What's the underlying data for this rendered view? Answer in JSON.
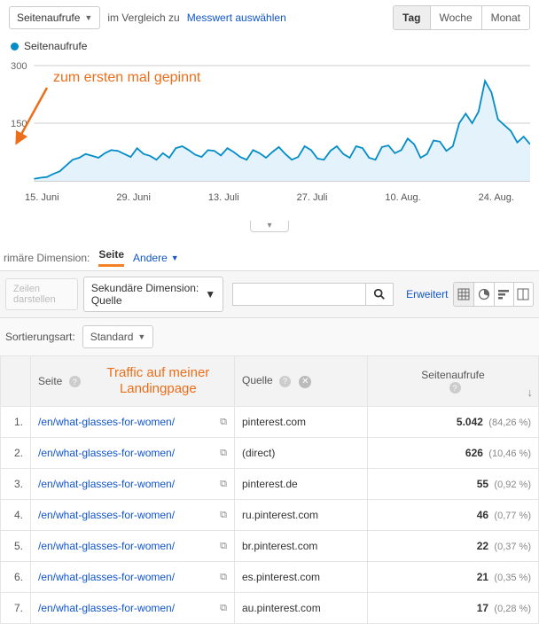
{
  "header": {
    "metric_dropdown": "Seitenaufrufe",
    "compare_label": "im Vergleich zu",
    "select_metric": "Messwert auswählen",
    "time_buttons": [
      "Tag",
      "Woche",
      "Monat"
    ],
    "time_selected": 0
  },
  "legend": {
    "label": "Seitenaufrufe"
  },
  "chart_data": {
    "type": "line",
    "title": "",
    "ylabel": "",
    "xlabel": "",
    "ylim": [
      0,
      300
    ],
    "yticks": [
      150,
      300
    ],
    "x_ticks": [
      "15. Juni",
      "29. Juni",
      "13. Juli",
      "27. Juli",
      "10. Aug.",
      "24. Aug."
    ],
    "series": [
      {
        "name": "Seitenaufrufe",
        "color": "#058dc7",
        "values": [
          5,
          8,
          10,
          18,
          25,
          40,
          55,
          60,
          70,
          65,
          60,
          72,
          80,
          78,
          70,
          62,
          85,
          70,
          65,
          55,
          72,
          60,
          85,
          90,
          80,
          68,
          62,
          80,
          78,
          66,
          85,
          75,
          62,
          55,
          80,
          72,
          60,
          75,
          88,
          70,
          55,
          62,
          90,
          80,
          58,
          55,
          78,
          90,
          70,
          60,
          90,
          85,
          60,
          55,
          88,
          92,
          72,
          80,
          110,
          95,
          60,
          70,
          105,
          102,
          78,
          90,
          150,
          175,
          150,
          180,
          260,
          230,
          160,
          145,
          130,
          100,
          115,
          95
        ]
      }
    ],
    "annotations": [
      "zum ersten mal gepinnt"
    ]
  },
  "dimension": {
    "label": "rimäre Dimension:",
    "primary": "Seite",
    "other": "Andere"
  },
  "filters": {
    "plot_rows": "Zeilen darstellen",
    "secondary_dim": "Sekundäre Dimension: Quelle",
    "advanced": "Erweitert",
    "search_placeholder": ""
  },
  "sort": {
    "label": "Sortierungsart:",
    "value": "Standard"
  },
  "table": {
    "headers": {
      "page": "Seite",
      "source": "Quelle",
      "pageviews": "Seitenaufrufe"
    },
    "annotation": "Traffic auf meiner Landingpage",
    "rows": [
      {
        "idx": "1.",
        "page": "/en/what-glasses-for-women/",
        "source": "pinterest.com",
        "pv": "5.042",
        "pct": "(84,26 %)"
      },
      {
        "idx": "2.",
        "page": "/en/what-glasses-for-women/",
        "source": "(direct)",
        "pv": "626",
        "pct": "(10,46 %)"
      },
      {
        "idx": "3.",
        "page": "/en/what-glasses-for-women/",
        "source": "pinterest.de",
        "pv": "55",
        "pct": "(0,92 %)"
      },
      {
        "idx": "4.",
        "page": "/en/what-glasses-for-women/",
        "source": "ru.pinterest.com",
        "pv": "46",
        "pct": "(0,77 %)"
      },
      {
        "idx": "5.",
        "page": "/en/what-glasses-for-women/",
        "source": "br.pinterest.com",
        "pv": "22",
        "pct": "(0,37 %)"
      },
      {
        "idx": "6.",
        "page": "/en/what-glasses-for-women/",
        "source": "es.pinterest.com",
        "pv": "21",
        "pct": "(0,35 %)"
      },
      {
        "idx": "7.",
        "page": "/en/what-glasses-for-women/",
        "source": "au.pinterest.com",
        "pv": "17",
        "pct": "(0,28 %)"
      }
    ]
  }
}
